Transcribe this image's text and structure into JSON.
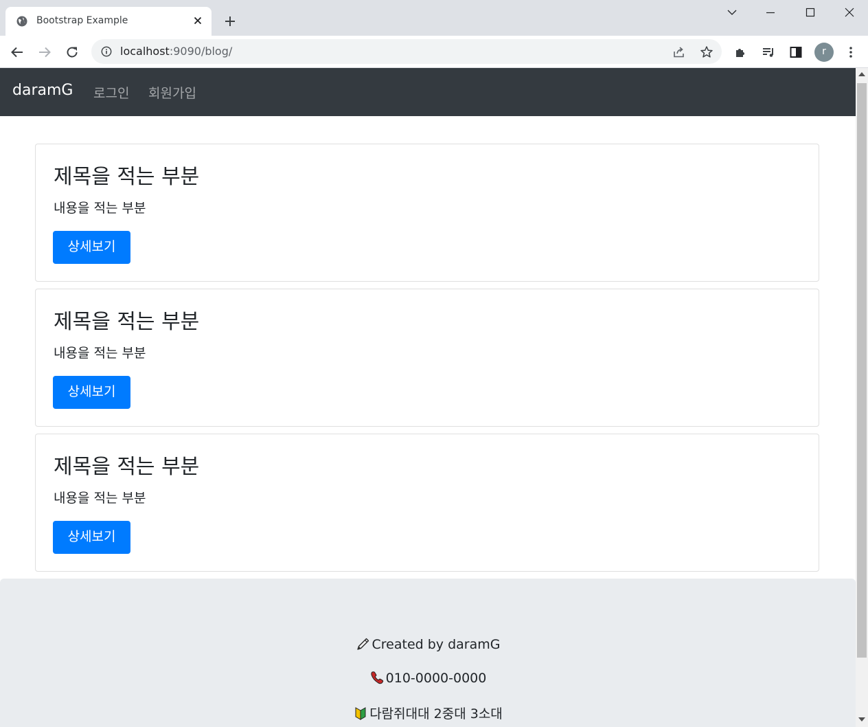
{
  "browser": {
    "tab_title": "Bootstrap Example",
    "url_host": "localhost",
    "url_rest": ":9090/blog/",
    "profile_initial": "r"
  },
  "navbar": {
    "brand": "daramG",
    "links": [
      "로그인",
      "회원가입"
    ]
  },
  "cards": [
    {
      "title": "제목을 적는 부분",
      "text": "내용을 적는 부분",
      "button": "상세보기"
    },
    {
      "title": "제목을 적는 부분",
      "text": "내용을 적는 부분",
      "button": "상세보기"
    },
    {
      "title": "제목을 적는 부분",
      "text": "내용을 적는 부분",
      "button": "상세보기"
    }
  ],
  "footer": {
    "created_by": "Created by daramG",
    "phone": "010-0000-0000",
    "unit": "다람쥐대대 2중대 3소대"
  },
  "colors": {
    "navbar_bg": "#343a40",
    "primary": "#007bff",
    "jumbotron_bg": "#e9ecef"
  }
}
